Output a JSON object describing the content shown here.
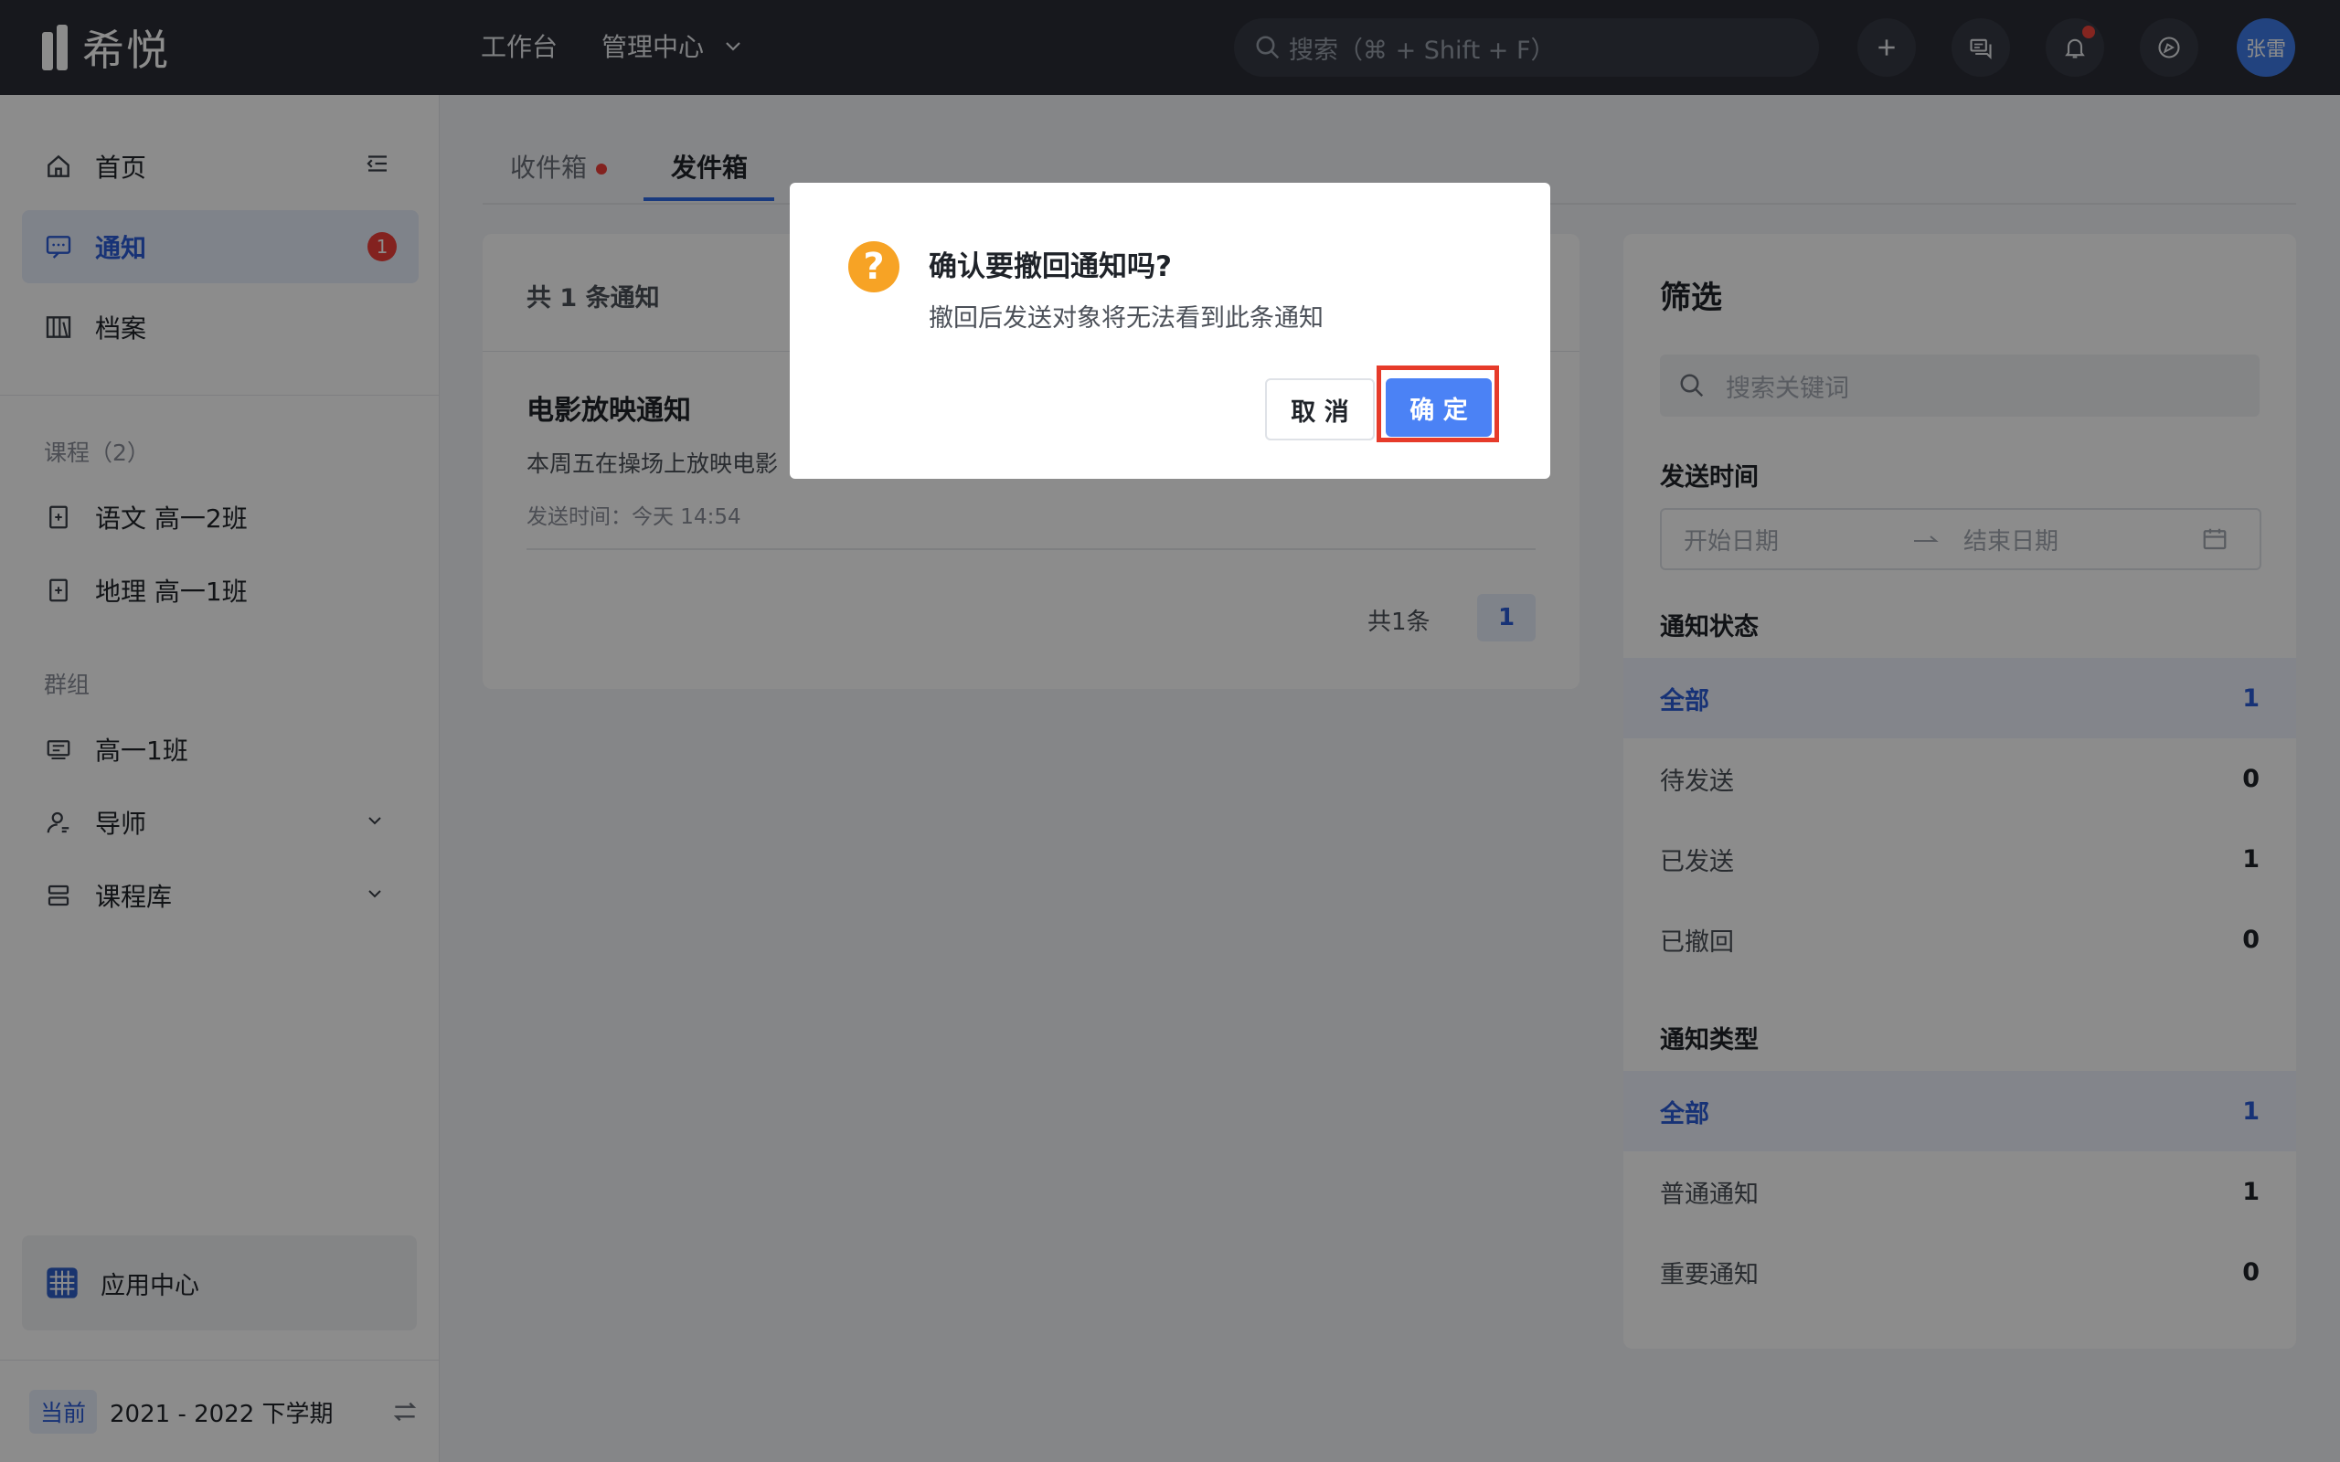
{
  "topbar": {
    "logo_text": "希悦",
    "nav": {
      "workbench": "工作台",
      "admin": "管理中心"
    },
    "search_placeholder": "搜索（⌘ + Shift + F）",
    "avatar_name": "张雷"
  },
  "sidebar": {
    "home": "首页",
    "notice": "通知",
    "notice_badge": "1",
    "archive": "档案",
    "courses_group": "课程（2）",
    "course_1": "语文 高一2班",
    "course_2": "地理 高一1班",
    "groups_group": "群组",
    "group_1": "高一1班",
    "mentor": "导师",
    "course_lib": "课程库",
    "app_center": "应用中心",
    "term_tag": "当前",
    "term": "2021 - 2022 下学期"
  },
  "tabs": {
    "inbox": "收件箱",
    "outbox": "发件箱"
  },
  "list": {
    "count": "共 1 条通知",
    "item_title": "电影放映通知",
    "item_desc": "本周五在操场上放映电影",
    "item_time": "发送时间：今天 14:54",
    "pager_total": "共1条",
    "pager_page": "1"
  },
  "filter": {
    "title": "筛选",
    "search_placeholder": "搜索关键词",
    "send_time_label": "发送时间",
    "date_start": "开始日期",
    "date_end": "结束日期",
    "status_label": "通知状态",
    "status": [
      {
        "label": "全部",
        "count": "1"
      },
      {
        "label": "待发送",
        "count": "0"
      },
      {
        "label": "已发送",
        "count": "1"
      },
      {
        "label": "已撤回",
        "count": "0"
      }
    ],
    "type_label": "通知类型",
    "types": [
      {
        "label": "全部",
        "count": "1"
      },
      {
        "label": "普通通知",
        "count": "1"
      },
      {
        "label": "重要通知",
        "count": "0"
      }
    ]
  },
  "dialog": {
    "icon": "?",
    "title": "确认要撤回通知吗?",
    "message": "撤回后发送对象将无法看到此条通知",
    "cancel": "取 消",
    "ok": "确 定"
  }
}
